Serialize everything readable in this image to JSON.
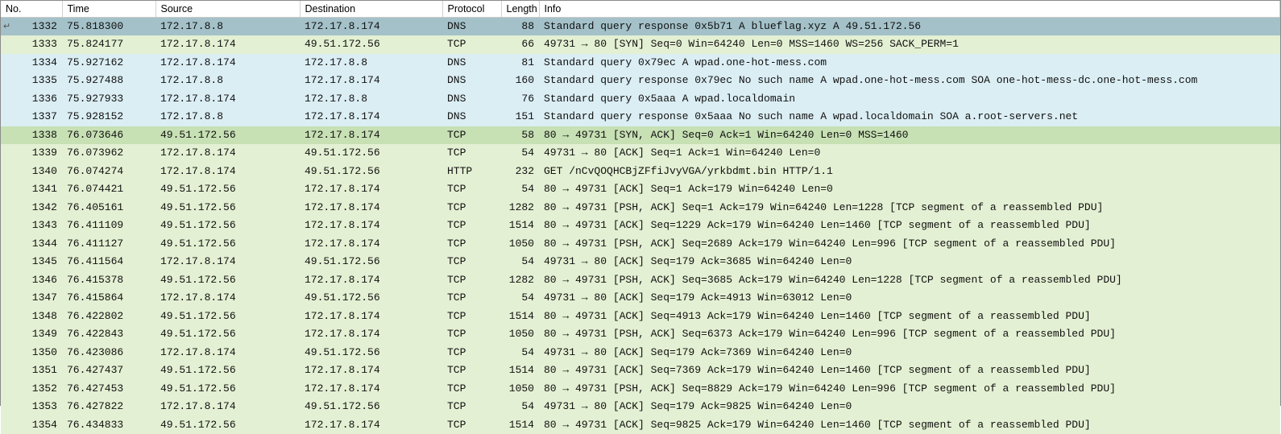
{
  "columns": [
    "No.",
    "Time",
    "Source",
    "Destination",
    "Protocol",
    "Length",
    "Info"
  ],
  "rows": [
    {
      "no": 1332,
      "time": "75.818300",
      "src": "172.17.8.8",
      "dst": "172.17.8.174",
      "proto": "DNS",
      "len": 88,
      "info": "Standard query response 0x5b71 A blueflag.xyz A 49.51.172.56",
      "cls": "row-dns-resp-sel"
    },
    {
      "no": 1333,
      "time": "75.824177",
      "src": "172.17.8.174",
      "dst": "49.51.172.56",
      "proto": "TCP",
      "len": 66,
      "info": "49731 → 80 [SYN] Seq=0 Win=64240 Len=0 MSS=1460 WS=256 SACK_PERM=1",
      "cls": "row-tcp-syn"
    },
    {
      "no": 1334,
      "time": "75.927162",
      "src": "172.17.8.174",
      "dst": "172.17.8.8",
      "proto": "DNS",
      "len": 81,
      "info": "Standard query 0x79ec A wpad.one-hot-mess.com",
      "cls": "row-dns"
    },
    {
      "no": 1335,
      "time": "75.927488",
      "src": "172.17.8.8",
      "dst": "172.17.8.174",
      "proto": "DNS",
      "len": 160,
      "info": "Standard query response 0x79ec No such name A wpad.one-hot-mess.com SOA one-hot-mess-dc.one-hot-mess.com",
      "cls": "row-dns"
    },
    {
      "no": 1336,
      "time": "75.927933",
      "src": "172.17.8.174",
      "dst": "172.17.8.8",
      "proto": "DNS",
      "len": 76,
      "info": "Standard query 0x5aaa A wpad.localdomain",
      "cls": "row-dns"
    },
    {
      "no": 1337,
      "time": "75.928152",
      "src": "172.17.8.8",
      "dst": "172.17.8.174",
      "proto": "DNS",
      "len": 151,
      "info": "Standard query response 0x5aaa No such name A wpad.localdomain SOA a.root-servers.net",
      "cls": "row-dns"
    },
    {
      "no": 1338,
      "time": "76.073646",
      "src": "49.51.172.56",
      "dst": "172.17.8.174",
      "proto": "TCP",
      "len": 58,
      "info": "80 → 49731 [SYN, ACK] Seq=0 Ack=1 Win=64240 Len=0 MSS=1460",
      "cls": "row-tcp-synack"
    },
    {
      "no": 1339,
      "time": "76.073962",
      "src": "172.17.8.174",
      "dst": "49.51.172.56",
      "proto": "TCP",
      "len": 54,
      "info": "49731 → 80 [ACK] Seq=1 Ack=1 Win=64240 Len=0",
      "cls": "row-tcp"
    },
    {
      "no": 1340,
      "time": "76.074274",
      "src": "172.17.8.174",
      "dst": "49.51.172.56",
      "proto": "HTTP",
      "len": 232,
      "info": "GET /nCvQOQHCBjZFfiJvyVGA/yrkbdmt.bin HTTP/1.1",
      "cls": "row-http"
    },
    {
      "no": 1341,
      "time": "76.074421",
      "src": "49.51.172.56",
      "dst": "172.17.8.174",
      "proto": "TCP",
      "len": 54,
      "info": "80 → 49731 [ACK] Seq=1 Ack=179 Win=64240 Len=0",
      "cls": "row-tcp"
    },
    {
      "no": 1342,
      "time": "76.405161",
      "src": "49.51.172.56",
      "dst": "172.17.8.174",
      "proto": "TCP",
      "len": 1282,
      "info": "80 → 49731 [PSH, ACK] Seq=1 Ack=179 Win=64240 Len=1228 [TCP segment of a reassembled PDU]",
      "cls": "row-tcp"
    },
    {
      "no": 1343,
      "time": "76.411109",
      "src": "49.51.172.56",
      "dst": "172.17.8.174",
      "proto": "TCP",
      "len": 1514,
      "info": "80 → 49731 [ACK] Seq=1229 Ack=179 Win=64240 Len=1460 [TCP segment of a reassembled PDU]",
      "cls": "row-tcp"
    },
    {
      "no": 1344,
      "time": "76.411127",
      "src": "49.51.172.56",
      "dst": "172.17.8.174",
      "proto": "TCP",
      "len": 1050,
      "info": "80 → 49731 [PSH, ACK] Seq=2689 Ack=179 Win=64240 Len=996 [TCP segment of a reassembled PDU]",
      "cls": "row-tcp"
    },
    {
      "no": 1345,
      "time": "76.411564",
      "src": "172.17.8.174",
      "dst": "49.51.172.56",
      "proto": "TCP",
      "len": 54,
      "info": "49731 → 80 [ACK] Seq=179 Ack=3685 Win=64240 Len=0",
      "cls": "row-tcp"
    },
    {
      "no": 1346,
      "time": "76.415378",
      "src": "49.51.172.56",
      "dst": "172.17.8.174",
      "proto": "TCP",
      "len": 1282,
      "info": "80 → 49731 [PSH, ACK] Seq=3685 Ack=179 Win=64240 Len=1228 [TCP segment of a reassembled PDU]",
      "cls": "row-tcp"
    },
    {
      "no": 1347,
      "time": "76.415864",
      "src": "172.17.8.174",
      "dst": "49.51.172.56",
      "proto": "TCP",
      "len": 54,
      "info": "49731 → 80 [ACK] Seq=179 Ack=4913 Win=63012 Len=0",
      "cls": "row-tcp"
    },
    {
      "no": 1348,
      "time": "76.422802",
      "src": "49.51.172.56",
      "dst": "172.17.8.174",
      "proto": "TCP",
      "len": 1514,
      "info": "80 → 49731 [ACK] Seq=4913 Ack=179 Win=64240 Len=1460 [TCP segment of a reassembled PDU]",
      "cls": "row-tcp"
    },
    {
      "no": 1349,
      "time": "76.422843",
      "src": "49.51.172.56",
      "dst": "172.17.8.174",
      "proto": "TCP",
      "len": 1050,
      "info": "80 → 49731 [PSH, ACK] Seq=6373 Ack=179 Win=64240 Len=996 [TCP segment of a reassembled PDU]",
      "cls": "row-tcp"
    },
    {
      "no": 1350,
      "time": "76.423086",
      "src": "172.17.8.174",
      "dst": "49.51.172.56",
      "proto": "TCP",
      "len": 54,
      "info": "49731 → 80 [ACK] Seq=179 Ack=7369 Win=64240 Len=0",
      "cls": "row-tcp"
    },
    {
      "no": 1351,
      "time": "76.427437",
      "src": "49.51.172.56",
      "dst": "172.17.8.174",
      "proto": "TCP",
      "len": 1514,
      "info": "80 → 49731 [ACK] Seq=7369 Ack=179 Win=64240 Len=1460 [TCP segment of a reassembled PDU]",
      "cls": "row-tcp"
    },
    {
      "no": 1352,
      "time": "76.427453",
      "src": "49.51.172.56",
      "dst": "172.17.8.174",
      "proto": "TCP",
      "len": 1050,
      "info": "80 → 49731 [PSH, ACK] Seq=8829 Ack=179 Win=64240 Len=996 [TCP segment of a reassembled PDU]",
      "cls": "row-tcp"
    },
    {
      "no": 1353,
      "time": "76.427822",
      "src": "172.17.8.174",
      "dst": "49.51.172.56",
      "proto": "TCP",
      "len": 54,
      "info": "49731 → 80 [ACK] Seq=179 Ack=9825 Win=64240 Len=0",
      "cls": "row-tcp"
    },
    {
      "no": 1354,
      "time": "76.434833",
      "src": "49.51.172.56",
      "dst": "172.17.8.174",
      "proto": "TCP",
      "len": 1514,
      "info": "80 → 49731 [ACK] Seq=9825 Ack=179 Win=64240 Len=1460 [TCP segment of a reassembled PDU]",
      "cls": "row-tcp"
    }
  ],
  "goto_marker": "↵"
}
